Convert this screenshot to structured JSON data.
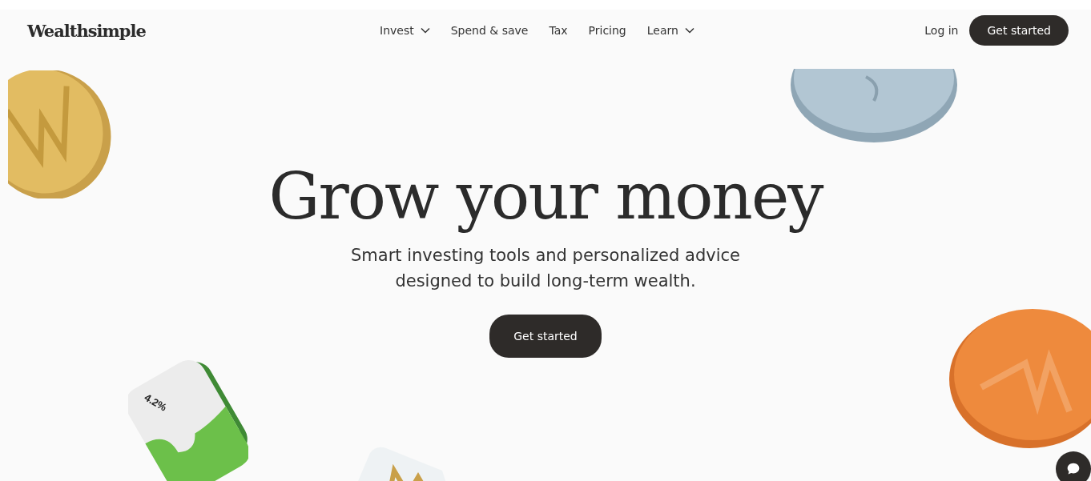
{
  "header": {
    "logo": "Wealthsimple",
    "nav": [
      {
        "label": "Invest",
        "dropdown": true
      },
      {
        "label": "Spend & save",
        "dropdown": false
      },
      {
        "label": "Tax",
        "dropdown": false
      },
      {
        "label": "Pricing",
        "dropdown": false
      },
      {
        "label": "Learn",
        "dropdown": true
      }
    ],
    "login": "Log in",
    "cta": "Get started"
  },
  "hero": {
    "title": "Grow your money",
    "subtitle": "Smart investing tools and personalized advice designed to build long-term wealth.",
    "cta": "Get started"
  },
  "tile": {
    "reading": "4.2%"
  }
}
